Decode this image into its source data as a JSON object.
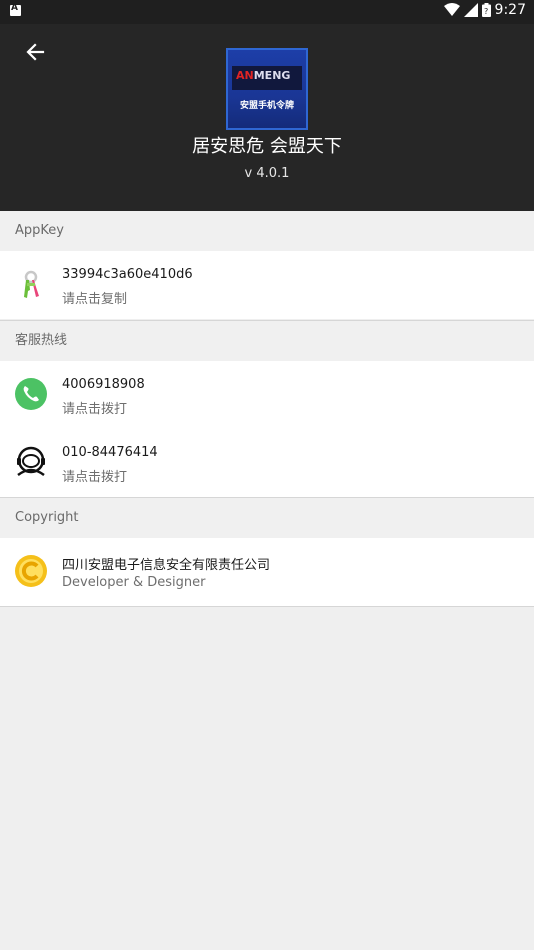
{
  "status_bar": {
    "time": "9:27"
  },
  "header": {
    "logo_brand": "ANMENG",
    "logo_caption": "安盟手机令牌",
    "slogan": "居安思危 会盟天下",
    "version": "v 4.0.1"
  },
  "sections": {
    "appkey": {
      "title": "AppKey",
      "value": "33994c3a60e410d6",
      "hint": "请点击复制",
      "icon": "keys-icon"
    },
    "hotline": {
      "title": "客服热线",
      "items": [
        {
          "value": "4006918908",
          "hint": "请点击拨打",
          "icon": "phone-icon"
        },
        {
          "value": "010-84476414",
          "hint": "请点击拨打",
          "icon": "headset-icon"
        }
      ]
    },
    "copyright": {
      "title": "Copyright",
      "company": "四川安盟电子信息安全有限责任公司",
      "role": "Developer & Designer",
      "icon": "copyright-icon"
    }
  },
  "colors": {
    "header_bg": "#262626",
    "phone_green": "#4cc264",
    "copyright_yellow": "#f5c01a"
  }
}
